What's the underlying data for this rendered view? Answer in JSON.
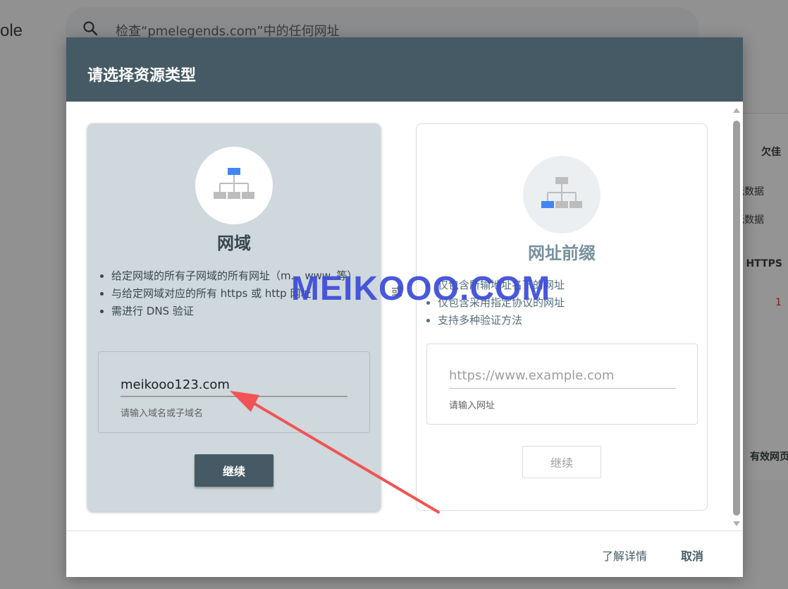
{
  "background": {
    "brand_fragment": "ole",
    "search_text": "检查“pmelegends.com”中的任何网址",
    "side_items": [
      "欠佳",
      "无数据",
      "无数据",
      "E HTTPS",
      "1",
      "有效网页"
    ]
  },
  "dialog": {
    "title": "请选择资源类型",
    "or_label": "或",
    "domain_card": {
      "title": "网域",
      "icon": "sitemap-icon",
      "bullets": [
        "给定网域的所有子网域的所有网址（m.、www. 等）",
        "与给定网域对应的所有 https 或 http 网址",
        "需进行 DNS 验证"
      ],
      "input_value": "meikooo123.com",
      "input_hint": "请输入域名或子域名",
      "continue_label": "继续"
    },
    "prefix_card": {
      "title": "网址前缀",
      "icon": "sitemap-icon",
      "bullets": [
        "仅包含所输地址名下的网址",
        "仅包含采用指定协议的网址",
        "支持多种验证方法"
      ],
      "input_placeholder": "https://www.example.com",
      "input_hint": "请输入网址",
      "continue_label": "继续"
    },
    "footer": {
      "learn_more": "了解详情",
      "cancel": "取消"
    }
  },
  "watermark": "MEIKOOO.COM",
  "colors": {
    "header": "#455a64",
    "domain_card_bg": "#cfd8dc",
    "accent_blue": "#4285f4",
    "annotation_red": "#f05454",
    "watermark": "#3b4bd9"
  }
}
